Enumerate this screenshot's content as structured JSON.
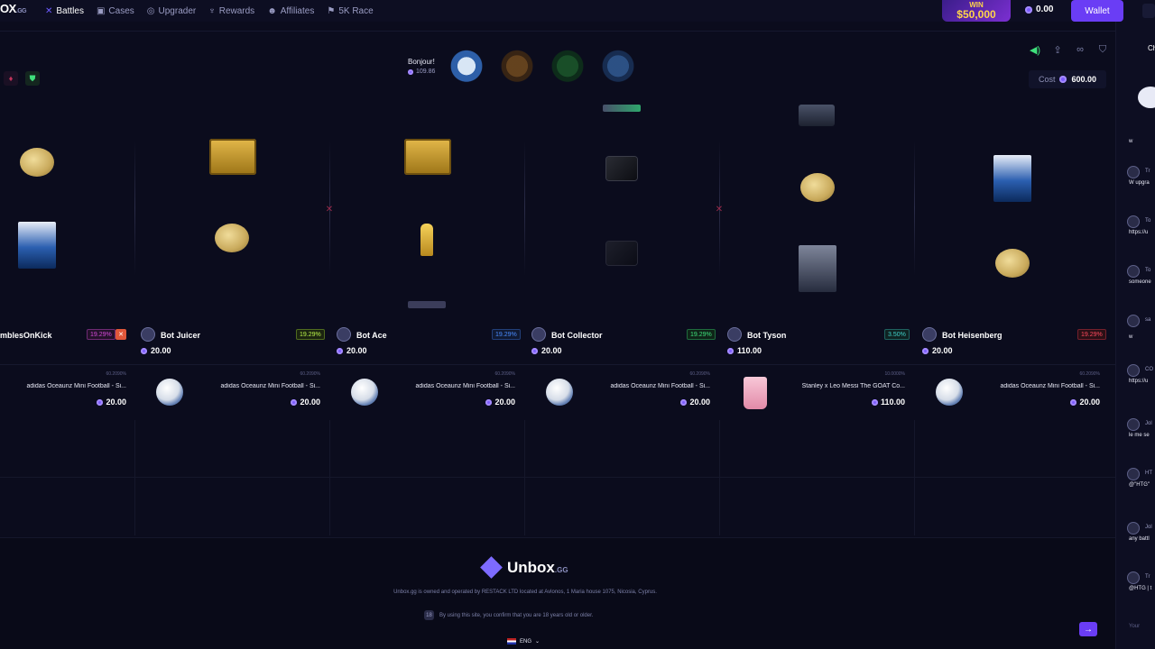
{
  "nav": {
    "logo_text": "OX",
    "logo_suffix": ".GG",
    "items": [
      {
        "label": "Battles",
        "icon": "swords-icon"
      },
      {
        "label": "Cases",
        "icon": "case-icon"
      },
      {
        "label": "Upgrader",
        "icon": "upgrade-icon"
      },
      {
        "label": "Rewards",
        "icon": "trophy-icon"
      },
      {
        "label": "Affiliates",
        "icon": "users-icon"
      },
      {
        "label": "5K Race",
        "icon": "race-icon"
      }
    ],
    "promo_line1": "WIN",
    "promo_line2": "$50,000",
    "balance": "0.00",
    "wallet_label": "Wallet"
  },
  "battle": {
    "greeting": "Bonjour!",
    "greeting_amount": "109.86",
    "cost_label": "Cost",
    "cost_value": "600.00"
  },
  "players": [
    {
      "name": "mblesOnKick",
      "amount": "",
      "pct": "19.29%",
      "pct_color": "pink",
      "flag": true
    },
    {
      "name": "Bot Juicer",
      "amount": "20.00",
      "pct": "19.29%",
      "pct_color": "lime"
    },
    {
      "name": "Bot Ace",
      "amount": "20.00",
      "pct": "19.29%",
      "pct_color": "blue"
    },
    {
      "name": "Bot Collector",
      "amount": "20.00",
      "pct": "19.29%",
      "pct_color": "green"
    },
    {
      "name": "Bot Tyson",
      "amount": "110.00",
      "pct": "3.50%",
      "pct_color": "teal"
    },
    {
      "name": "Bot Heisenberg",
      "amount": "20.00",
      "pct": "19.29%",
      "pct_color": "red"
    }
  ],
  "won_items": [
    {
      "odds": "60.2090%",
      "name": "adidas Oceaunz Mini Football - Si...",
      "price": "20.00",
      "kind": "ball"
    },
    {
      "odds": "60.2090%",
      "name": "adidas Oceaunz Mini Football - Si...",
      "price": "20.00",
      "kind": "ball"
    },
    {
      "odds": "60.2090%",
      "name": "adidas Oceaunz Mini Football - Si...",
      "price": "20.00",
      "kind": "ball"
    },
    {
      "odds": "60.2090%",
      "name": "adidas Oceaunz Mini Football - Si...",
      "price": "20.00",
      "kind": "ball"
    },
    {
      "odds": "10.0000%",
      "name": "Stanley x Leo Messi The GOAT Co...",
      "price": "110.00",
      "kind": "tumbler"
    },
    {
      "odds": "60.2090%",
      "name": "adidas Oceaunz Mini Football - Si...",
      "price": "20.00",
      "kind": "ball"
    }
  ],
  "footer": {
    "brand": "Unbox",
    "brand_suffix": ".GG",
    "legal": "Unbox.gg is owned and operated by RESTACK LTD located at Avlonos, 1 Maria house 1075, Nicosia, Cyprus.",
    "age_notice": "By using this site, you confirm that you are 18 years old or older.",
    "language": "ENG"
  },
  "chat": {
    "title": "Ch",
    "messages": [
      {
        "user": "",
        "text": "w"
      },
      {
        "user": "Tr",
        "text": "W upgra"
      },
      {
        "user": "To",
        "text": "https://u"
      },
      {
        "user": "To",
        "text": "someone"
      },
      {
        "user": "sa",
        "text": "w"
      },
      {
        "user": "CO",
        "text": "https://u"
      },
      {
        "user": "Jol",
        "text": "le me se"
      },
      {
        "user": "HT",
        "text": "@\"HTG\""
      },
      {
        "user": "Jol",
        "text": "any battl"
      },
      {
        "user": "Tr",
        "text": "@HTG | t"
      }
    ],
    "input_placeholder": "Your"
  }
}
